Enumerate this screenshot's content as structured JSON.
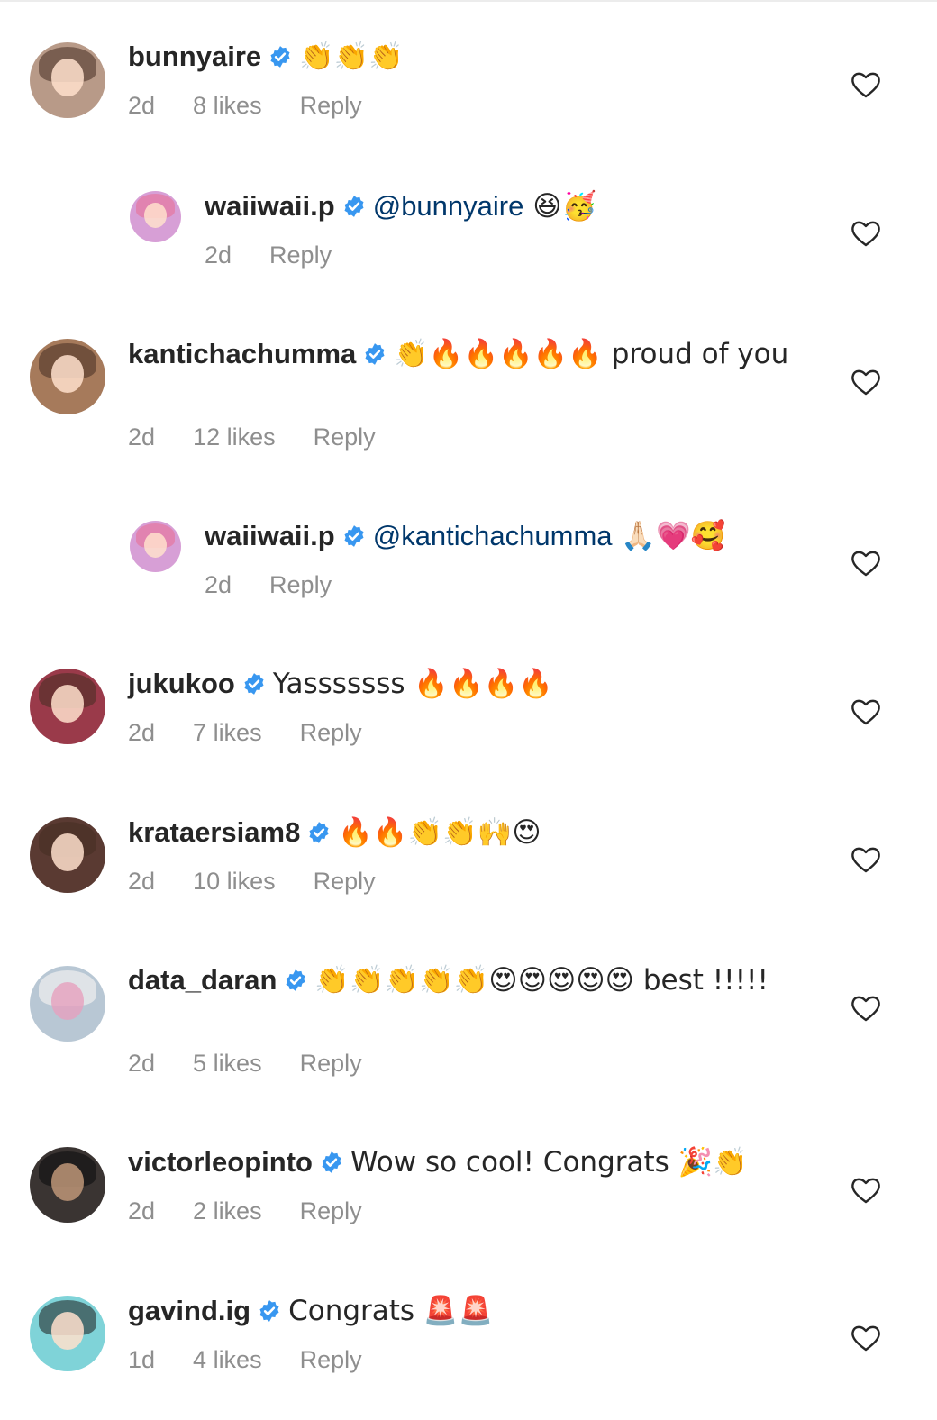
{
  "comments": [
    {
      "username": "bunnyaire",
      "text": "👏👏👏",
      "mention": "",
      "time": "2d",
      "likes": "8 likes",
      "reply_label": "Reply",
      "avatar_color": "#b89a88"
    },
    {
      "username": "waiiwaii.p",
      "mention": "@bunnyaire",
      "text": " 😆🥳",
      "time": "2d",
      "likes": "",
      "reply_label": "Reply",
      "avatar_color": "#d79fd6"
    },
    {
      "username": "kantichachumma",
      "text": "👏🔥🔥🔥🔥🔥 proud of you",
      "mention": "",
      "time": "2d",
      "likes": "12 likes",
      "reply_label": "Reply",
      "avatar_color": "#a67a5b"
    },
    {
      "username": "waiiwaii.p",
      "mention": "@kantichachumma",
      "text": " 🙏🏻💗🥰",
      "time": "2d",
      "likes": "",
      "reply_label": "Reply",
      "avatar_color": "#d79fd6"
    },
    {
      "username": "jukukoo",
      "text": "Yasssssss 🔥🔥🔥🔥",
      "mention": "",
      "time": "2d",
      "likes": "7 likes",
      "reply_label": "Reply",
      "avatar_color": "#9a3a4a"
    },
    {
      "username": "krataersiam8",
      "text": "🔥🔥👏👏🙌😍",
      "mention": "",
      "time": "2d",
      "likes": "10 likes",
      "reply_label": "Reply",
      "avatar_color": "#5a3a32"
    },
    {
      "username": "data_daran",
      "text": "👏👏👏👏👏😍😍😍😍😍 best !!!!!",
      "mention": "",
      "time": "2d",
      "likes": "5 likes",
      "reply_label": "Reply",
      "avatar_color": "#b8c7d4"
    },
    {
      "username": "victorleopinto",
      "text": "Wow so cool! Congrats 🎉👏",
      "mention": "",
      "time": "2d",
      "likes": "2 likes",
      "reply_label": "Reply",
      "avatar_color": "#3a3432"
    },
    {
      "username": "gavind.ig",
      "text": "Congrats 🚨🚨",
      "mention": "",
      "time": "1d",
      "likes": "4 likes",
      "reply_label": "Reply",
      "avatar_color": "#7fd3d8"
    }
  ],
  "colors": {
    "verified_badge": "#3897f0",
    "mention": "#00376b",
    "meta_text": "#8e8e8e"
  },
  "icons": {
    "verified": "verified-badge-icon",
    "like": "heart-outline-icon"
  }
}
